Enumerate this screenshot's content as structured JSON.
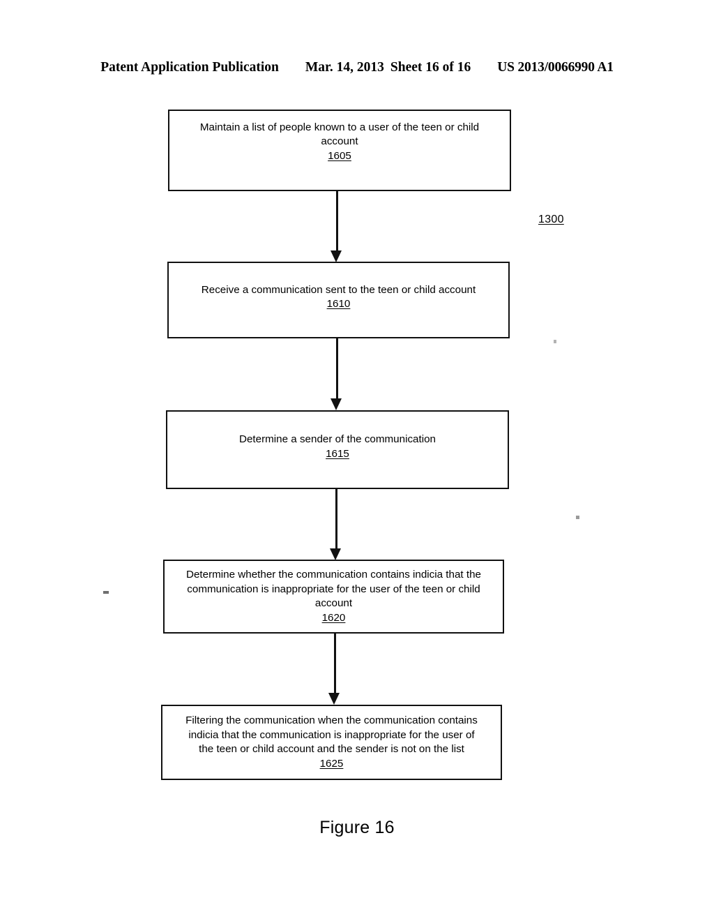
{
  "header": {
    "publication": "Patent Application Publication",
    "date": "Mar. 14, 2013",
    "sheet": "Sheet 16 of 16",
    "patent_number": "US 2013/0066990 A1"
  },
  "figure": {
    "caption": "Figure 16",
    "diagram_ref": "1300"
  },
  "flowchart": {
    "nodes": [
      {
        "id": "1605",
        "text": "Maintain a list of people known to a user of the teen or child\naccount",
        "ref": "1605"
      },
      {
        "id": "1610",
        "text": "Receive a communication sent to the teen or child account",
        "ref": "1610"
      },
      {
        "id": "1615",
        "text": "Determine a sender of the communication",
        "ref": "1615"
      },
      {
        "id": "1620",
        "text": "Determine whether the communication contains indicia that the\ncommunication is inappropriate for the user of the teen or child\naccount",
        "ref": "1620"
      },
      {
        "id": "1625",
        "text": "Filtering the communication when the communication contains\nindicia that the communication is inappropriate for the user of\nthe teen or child account and the sender is not on the list",
        "ref": "1625"
      }
    ]
  }
}
